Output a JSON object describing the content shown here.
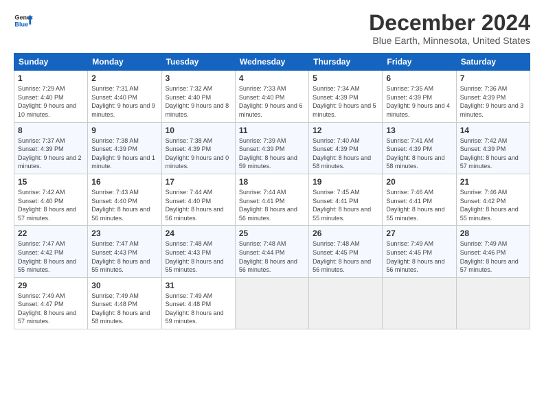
{
  "logo": {
    "line1": "General",
    "line2": "Blue"
  },
  "title": "December 2024",
  "subtitle": "Blue Earth, Minnesota, United States",
  "headers": [
    "Sunday",
    "Monday",
    "Tuesday",
    "Wednesday",
    "Thursday",
    "Friday",
    "Saturday"
  ],
  "weeks": [
    [
      {
        "day": "1",
        "rise": "7:29 AM",
        "set": "4:40 PM",
        "daylight": "9 hours and 10 minutes."
      },
      {
        "day": "2",
        "rise": "7:31 AM",
        "set": "4:40 PM",
        "daylight": "9 hours and 9 minutes."
      },
      {
        "day": "3",
        "rise": "7:32 AM",
        "set": "4:40 PM",
        "daylight": "9 hours and 8 minutes."
      },
      {
        "day": "4",
        "rise": "7:33 AM",
        "set": "4:40 PM",
        "daylight": "9 hours and 6 minutes."
      },
      {
        "day": "5",
        "rise": "7:34 AM",
        "set": "4:39 PM",
        "daylight": "9 hours and 5 minutes."
      },
      {
        "day": "6",
        "rise": "7:35 AM",
        "set": "4:39 PM",
        "daylight": "9 hours and 4 minutes."
      },
      {
        "day": "7",
        "rise": "7:36 AM",
        "set": "4:39 PM",
        "daylight": "9 hours and 3 minutes."
      }
    ],
    [
      {
        "day": "8",
        "rise": "7:37 AM",
        "set": "4:39 PM",
        "daylight": "9 hours and 2 minutes."
      },
      {
        "day": "9",
        "rise": "7:38 AM",
        "set": "4:39 PM",
        "daylight": "9 hours and 1 minute."
      },
      {
        "day": "10",
        "rise": "7:38 AM",
        "set": "4:39 PM",
        "daylight": "9 hours and 0 minutes."
      },
      {
        "day": "11",
        "rise": "7:39 AM",
        "set": "4:39 PM",
        "daylight": "8 hours and 59 minutes."
      },
      {
        "day": "12",
        "rise": "7:40 AM",
        "set": "4:39 PM",
        "daylight": "8 hours and 58 minutes."
      },
      {
        "day": "13",
        "rise": "7:41 AM",
        "set": "4:39 PM",
        "daylight": "8 hours and 58 minutes."
      },
      {
        "day": "14",
        "rise": "7:42 AM",
        "set": "4:39 PM",
        "daylight": "8 hours and 57 minutes."
      }
    ],
    [
      {
        "day": "15",
        "rise": "7:42 AM",
        "set": "4:40 PM",
        "daylight": "8 hours and 57 minutes."
      },
      {
        "day": "16",
        "rise": "7:43 AM",
        "set": "4:40 PM",
        "daylight": "8 hours and 56 minutes."
      },
      {
        "day": "17",
        "rise": "7:44 AM",
        "set": "4:40 PM",
        "daylight": "8 hours and 56 minutes."
      },
      {
        "day": "18",
        "rise": "7:44 AM",
        "set": "4:41 PM",
        "daylight": "8 hours and 56 minutes."
      },
      {
        "day": "19",
        "rise": "7:45 AM",
        "set": "4:41 PM",
        "daylight": "8 hours and 55 minutes."
      },
      {
        "day": "20",
        "rise": "7:46 AM",
        "set": "4:41 PM",
        "daylight": "8 hours and 55 minutes."
      },
      {
        "day": "21",
        "rise": "7:46 AM",
        "set": "4:42 PM",
        "daylight": "8 hours and 55 minutes."
      }
    ],
    [
      {
        "day": "22",
        "rise": "7:47 AM",
        "set": "4:42 PM",
        "daylight": "8 hours and 55 minutes."
      },
      {
        "day": "23",
        "rise": "7:47 AM",
        "set": "4:43 PM",
        "daylight": "8 hours and 55 minutes."
      },
      {
        "day": "24",
        "rise": "7:48 AM",
        "set": "4:43 PM",
        "daylight": "8 hours and 55 minutes."
      },
      {
        "day": "25",
        "rise": "7:48 AM",
        "set": "4:44 PM",
        "daylight": "8 hours and 56 minutes."
      },
      {
        "day": "26",
        "rise": "7:48 AM",
        "set": "4:45 PM",
        "daylight": "8 hours and 56 minutes."
      },
      {
        "day": "27",
        "rise": "7:49 AM",
        "set": "4:45 PM",
        "daylight": "8 hours and 56 minutes."
      },
      {
        "day": "28",
        "rise": "7:49 AM",
        "set": "4:46 PM",
        "daylight": "8 hours and 57 minutes."
      }
    ],
    [
      {
        "day": "29",
        "rise": "7:49 AM",
        "set": "4:47 PM",
        "daylight": "8 hours and 57 minutes."
      },
      {
        "day": "30",
        "rise": "7:49 AM",
        "set": "4:48 PM",
        "daylight": "8 hours and 58 minutes."
      },
      {
        "day": "31",
        "rise": "7:49 AM",
        "set": "4:48 PM",
        "daylight": "8 hours and 59 minutes."
      },
      null,
      null,
      null,
      null
    ]
  ],
  "labels": {
    "sunrise": "Sunrise:",
    "sunset": "Sunset:",
    "daylight": "Daylight:"
  }
}
